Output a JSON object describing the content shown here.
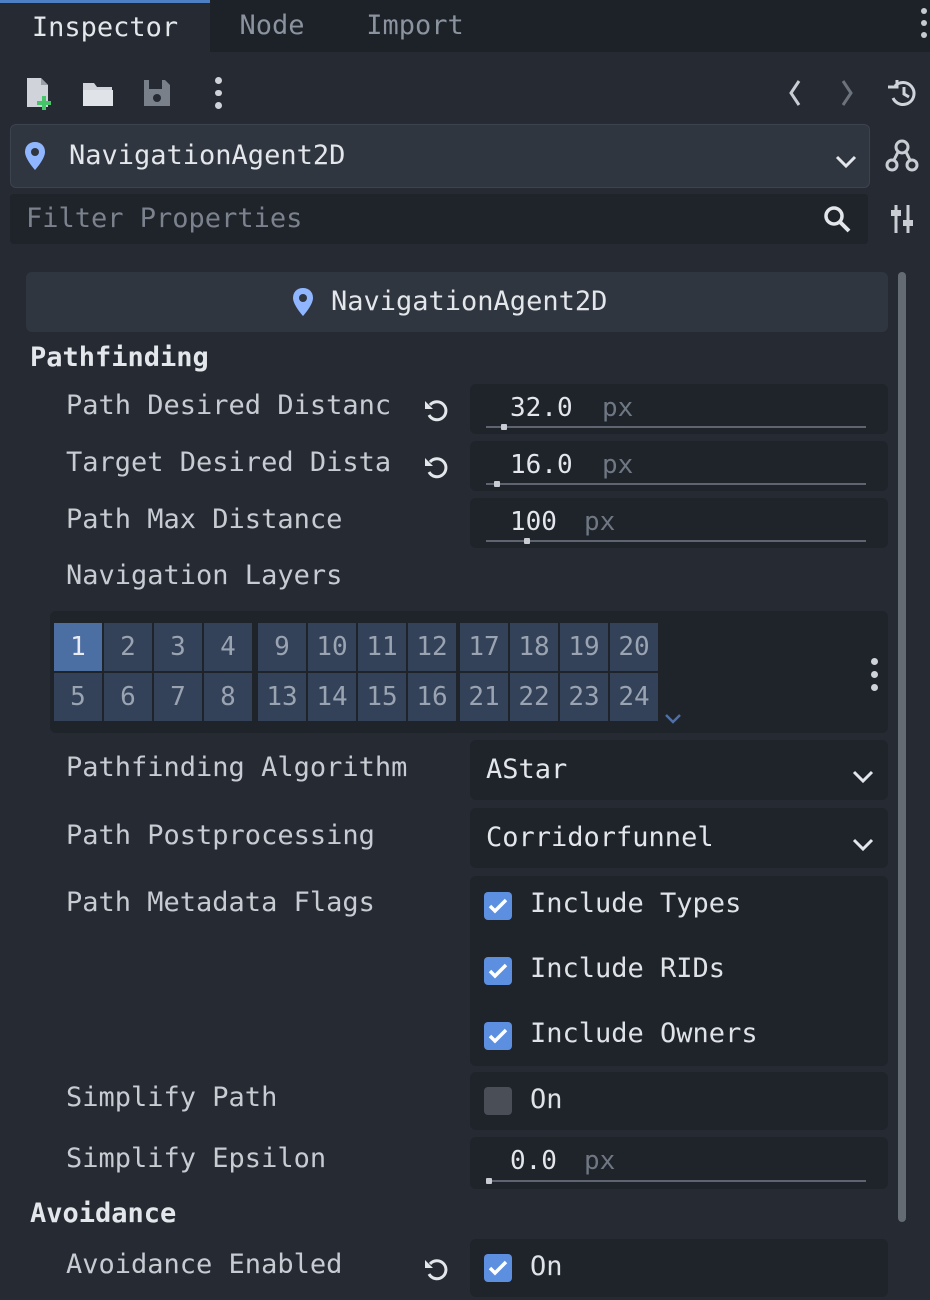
{
  "tabs": [
    {
      "label": "Inspector"
    },
    {
      "label": "Node"
    },
    {
      "label": "Import"
    }
  ],
  "toolbar": {
    "icons": [
      "new-resource-icon",
      "open-folder-icon",
      "save-icon",
      "more-icon",
      "back-icon",
      "forward-icon",
      "history-icon"
    ]
  },
  "node_selector": {
    "label": "NavigationAgent2D"
  },
  "filter": {
    "placeholder": "Filter Properties"
  },
  "class_header": {
    "label": "NavigationAgent2D"
  },
  "sections": {
    "pathfinding": "Pathfinding",
    "avoidance": "Avoidance"
  },
  "props": {
    "path_desired_distance": {
      "label": "Path Desired Distanc",
      "value": "32.0",
      "unit": "px",
      "slider": 0.04
    },
    "target_desired_distance": {
      "label": "Target Desired Dista",
      "value": "16.0",
      "unit": "px",
      "slider": 0.02
    },
    "path_max_distance": {
      "label": "Path Max Distance",
      "value": "100",
      "unit": "px",
      "slider": 0.1
    },
    "navigation_layers": {
      "label": "Navigation Layers",
      "active": [
        1
      ]
    },
    "pathfinding_algorithm": {
      "label": "Pathfinding Algorithm",
      "value": "AStar"
    },
    "path_postprocessing": {
      "label": "Path Postprocessing",
      "value": "Corridorfunnel"
    },
    "path_metadata_flags": {
      "label": "Path Metadata Flags",
      "options": [
        {
          "label": "Include Types",
          "checked": true
        },
        {
          "label": "Include RIDs",
          "checked": true
        },
        {
          "label": "Include Owners",
          "checked": true
        }
      ]
    },
    "simplify_path": {
      "label": "Simplify Path",
      "checked": false,
      "text": "On"
    },
    "simplify_epsilon": {
      "label": "Simplify Epsilon",
      "value": "0.0",
      "unit": "px",
      "slider": 0.0
    },
    "avoidance_enabled": {
      "label": "Avoidance Enabled",
      "checked": true,
      "text": "On"
    }
  },
  "layer_cells": {
    "row1": [
      "1",
      "2",
      "3",
      "4",
      "9",
      "10",
      "11",
      "12",
      "17",
      "18",
      "19",
      "20"
    ],
    "row2": [
      "5",
      "6",
      "7",
      "8",
      "13",
      "14",
      "15",
      "16",
      "21",
      "22",
      "23",
      "24"
    ]
  },
  "colors": {
    "accent": "#4e7fc4",
    "checkbox": "#5c8fe0",
    "active_layer": "#4b6ea3"
  }
}
